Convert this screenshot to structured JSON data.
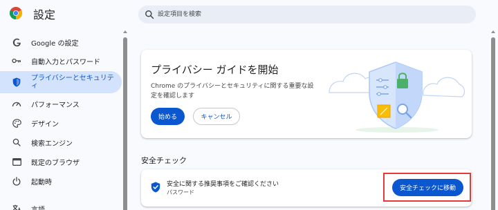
{
  "header": {
    "app_title": "設定",
    "search_placeholder": "設定項目を検索"
  },
  "sidebar": {
    "items": [
      {
        "label": "Google の設定",
        "icon": "google-g-icon"
      },
      {
        "label": "自動入力とパスワード",
        "icon": "key-icon"
      },
      {
        "label": "プライバシーとセキュリティ",
        "icon": "shield-icon",
        "active": true
      },
      {
        "label": "パフォーマンス",
        "icon": "speedometer-icon"
      },
      {
        "label": "デザイン",
        "icon": "palette-icon"
      },
      {
        "label": "検索エンジン",
        "icon": "search-icon"
      },
      {
        "label": "既定のブラウザ",
        "icon": "browser-window-icon"
      },
      {
        "label": "起動時",
        "icon": "power-icon"
      },
      {
        "label": "言語",
        "icon": "translate-icon"
      }
    ]
  },
  "privacy_guide": {
    "title": "プライバシー ガイドを開始",
    "description": "Chrome のプライバシーとセキュリティに関する重要な設定を確認します",
    "start_label": "始める",
    "cancel_label": "キャンセル"
  },
  "safety_check": {
    "section_title": "安全チェック",
    "message": "安全に関する推奨事項をご確認ください",
    "sublabel": "パスワード",
    "button_label": "安全チェックに移動"
  },
  "colors": {
    "accent": "#0b57d0",
    "active_bg": "#d3e3fd",
    "highlight_border": "#e53935",
    "background": "#f8fafd"
  }
}
